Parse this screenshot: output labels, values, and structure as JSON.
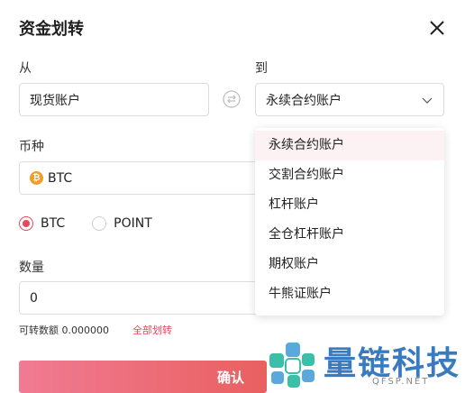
{
  "dialog": {
    "title": "资金划转",
    "from_label": "从",
    "to_label": "到",
    "from_value": "现货账户",
    "to_value": "永续合约账户",
    "currency_label": "币种",
    "currency_value": "BTC",
    "currency_icon": "bitcoin-icon",
    "radio_options": [
      {
        "label": "BTC",
        "selected": true
      },
      {
        "label": "POINT",
        "selected": false
      }
    ],
    "quantity_label": "数量",
    "quantity_value": "0",
    "available_text": "可转数额 0.000000",
    "transfer_all": "全部划转",
    "confirm_label": "确认"
  },
  "dropdown": {
    "items": [
      "永续合约账户",
      "交割合约账户",
      "杠杆账户",
      "全仓杠杆账户",
      "期权账户",
      "牛熊证账户"
    ],
    "selected_index": 0
  },
  "watermark": {
    "text": "量链科技",
    "subtext": "QFSP.NET"
  },
  "colors": {
    "accent": "#e8485a",
    "button_start": "#f07b93",
    "button_end": "#e96060",
    "coin": "#f39c2b",
    "logo": "#3a7bbf"
  }
}
